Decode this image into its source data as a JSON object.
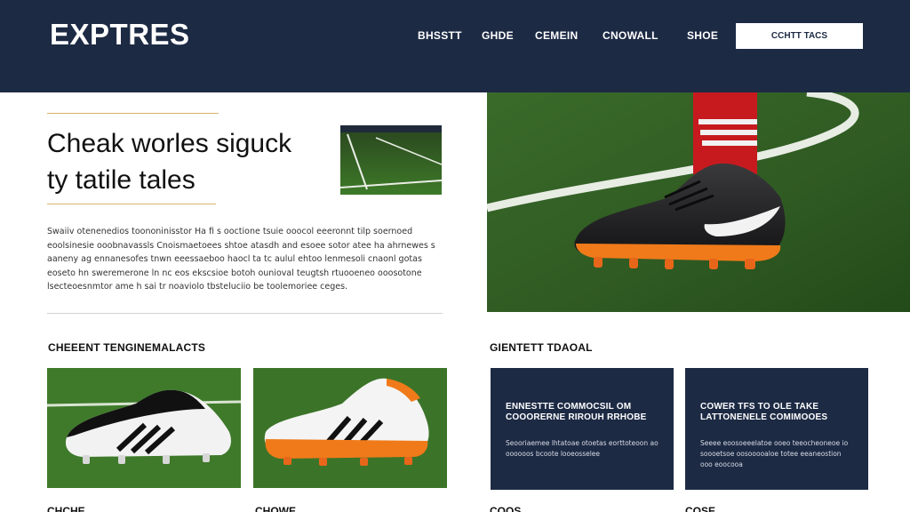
{
  "header": {
    "logo": "EXPTRES",
    "nav": [
      "BHSSTT",
      "GHDE",
      "CEMEIN",
      "CNOWALL",
      "SHOE"
    ],
    "cta_label": "CCHTT TACS"
  },
  "hero": {
    "title_line1": "Cheak worles siguck",
    "title_line2": "ty tatile tales",
    "body": "Swaiiv otenenedios toononinisstor Ha fi s ooctione tsuie ooocol eeeronnt tilp soernoed eoolsinesie ooobnavassls Cnoismaetoees shtoe atasdh and esoee sotor atee ha ahrnewes s aaneny ag ennanesofes tnwn eeessaeboo haocl ta tc aulul ehtoo lenmesoli cnaonl gotas eoseto hn sweremerone ln nc eos ekscsioe botoh ounioval teugtsh rtuooeneo ooosotone lsecteoesnmtor ame h sai tr noaviolo tbsteluciio be toolemoriee ceges.",
    "colors": {
      "navy": "#1d2a44",
      "accent_rule": "#d9b56a",
      "sole_orange": "#f07a1a"
    }
  },
  "sections": {
    "left_heading": "CHEEENT TENGINEMALACTS",
    "right_heading": "GIENTETT TDAOAL"
  },
  "dark_cards": [
    {
      "title": "ENNESTTE COMMOCSIL OM COOORERNE RIROUH RRHOBE",
      "body": "Seooriaemee lhtatoae otoetas eorttoteoon ao oooooos bcoote looeosselee"
    },
    {
      "title": "COWER TFS TO OLE TAKE LATTONENELE COMIMOOES",
      "body": "Seeee eoosoeeelatoe ooeo teeocheoneoe io soooetsoe oosooooaloe totee eeaneostion ooo eoocooa"
    }
  ],
  "bottom_labels": [
    "CHCHE",
    "CHOWE",
    "COOS",
    "COSE"
  ]
}
